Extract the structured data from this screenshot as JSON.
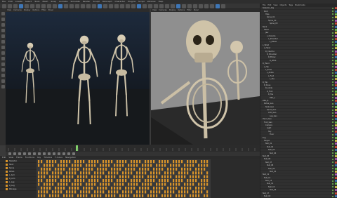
{
  "menu": [
    "File",
    "Edit",
    "Create",
    "Select",
    "Tools",
    "Mesh",
    "Snap",
    "Animate",
    "Simulate",
    "Render",
    "Sculpt",
    "MoGraph",
    "Character",
    "Plugins",
    "Script",
    "Window",
    "Help"
  ],
  "viewport_left": {
    "tabs": [
      "View",
      "Cameras",
      "Display",
      "Options",
      "Filter",
      "Panel"
    ]
  },
  "viewport_right": {
    "tabs": [
      "View",
      "Cameras",
      "Display",
      "Options",
      "Filter",
      "Panel"
    ]
  },
  "dope_menu": [
    "Edit",
    "View",
    "Frame",
    "Functions",
    "Key",
    "Timeline",
    "F-Curve",
    "Navigation"
  ],
  "tracks": [
    "Skeleton",
    "Skull",
    "Spine",
    "Pelvis",
    "L_Arm",
    "R_Arm",
    "L_Leg",
    "R_Leg",
    "Ribcage"
  ],
  "panel_tabs": [
    "File",
    "Edit",
    "View",
    "Objects",
    "Tags",
    "Bookmarks"
  ],
  "objects": [
    "Skeleton_Rig",
    "Root",
    "Hips",
    "Spine_01",
    "Spine_02",
    "Spine_03",
    "Neck",
    "Head",
    "Jaw",
    "L_Clavicle",
    "L_Shoulder",
    "L_Elbow",
    "L_Wrist",
    "L_Hand",
    "R_Clavicle",
    "R_Shoulder",
    "R_Elbow",
    "R_Wrist",
    "R_Hand",
    "L_Hip",
    "L_Knee",
    "L_Ankle",
    "L_Foot",
    "L_Toe",
    "R_Hip",
    "R_Knee",
    "R_Ankle",
    "R_Foot",
    "R_Toe",
    "Ribs_L",
    "Ribs_R",
    "Pelvis_Geo",
    "Skull_Geo",
    "Spine_Geo",
    "Arm_Geo",
    "Leg_Geo",
    "Hand_Geo",
    "Foot_Geo",
    "Camera",
    "Light",
    "Sky",
    "Floor",
    "Fog",
    "Target",
    "Null_01",
    "Null_02",
    "Null_03",
    "Null_04",
    "Null_05",
    "Null_06",
    "Null_07",
    "Null_08",
    "Null_09",
    "Null_10",
    "Null_11",
    "Null_12",
    "Null_13",
    "Null_14",
    "Null_15",
    "Null_16",
    "Null_17",
    "Null_18"
  ],
  "colors": {
    "key_orange": "#d9942a",
    "bg": "#3a3a3a",
    "floor": "#8d8d8d"
  }
}
